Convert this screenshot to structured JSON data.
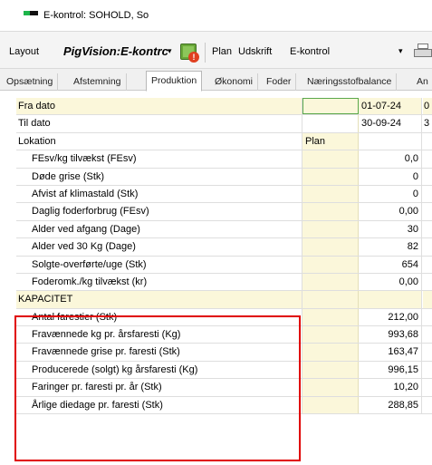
{
  "window": {
    "title": "E-kontrol: SOHOLD, So"
  },
  "toolbar": {
    "layout_label": "Layout",
    "layout_value": "PigVision:E-kontrc",
    "dropdown_glyph": "▾",
    "plan_label": "Plan",
    "udskrift_label": "Udskrift",
    "udskrift_value": "E-kontrol"
  },
  "tabs": [
    "Opsætning",
    "Afstemning",
    "Produktion",
    "Økonomi",
    "Foder",
    "Næringsstofbalance",
    "An"
  ],
  "active_tab": "Produktion",
  "grid": {
    "rows": [
      {
        "label": "Fra dato",
        "plan": "",
        "value": "01-07-24",
        "edge": "0"
      },
      {
        "label": "Til dato",
        "plan": "",
        "value": "30-09-24",
        "edge": "3"
      },
      {
        "label": "Lokation",
        "plan": "Plan",
        "value": "",
        "edge": ""
      },
      {
        "label": "FEsv/kg tilvækst (FEsv)",
        "plan": "",
        "value": "0,0",
        "edge": ""
      },
      {
        "label": "Døde grise (Stk)",
        "plan": "",
        "value": "0",
        "edge": ""
      },
      {
        "label": "Afvist af klimastald (Stk)",
        "plan": "",
        "value": "0",
        "edge": ""
      },
      {
        "label": "Daglig foderforbrug (FEsv)",
        "plan": "",
        "value": "0,00",
        "edge": ""
      },
      {
        "label": "Alder ved afgang (Dage)",
        "plan": "",
        "value": "30",
        "edge": ""
      },
      {
        "label": "Alder ved 30 Kg (Dage)",
        "plan": "",
        "value": "82",
        "edge": ""
      },
      {
        "label": "Solgte-overførte/uge (Stk)",
        "plan": "",
        "value": "654",
        "edge": ""
      },
      {
        "label": "Foderomk./kg tilvækst (kr)",
        "plan": "",
        "value": "0,00",
        "edge": ""
      },
      {
        "label": "KAPACITET",
        "plan": "",
        "value": "",
        "edge": ""
      },
      {
        "label": "Antal farestier (Stk)",
        "plan": "",
        "value": "212,00",
        "edge": ""
      },
      {
        "label": "Fravænnede kg pr. årsfaresti (Kg)",
        "plan": "",
        "value": "993,68",
        "edge": ""
      },
      {
        "label": "Fravænnede grise pr. faresti (Stk)",
        "plan": "",
        "value": "163,47",
        "edge": ""
      },
      {
        "label": "Producerede (solgt) kg årsfaresti (Kg)",
        "plan": "",
        "value": "996,15",
        "edge": ""
      },
      {
        "label": "Faringer pr. faresti pr. år (Stk)",
        "plan": "",
        "value": "10,20",
        "edge": ""
      },
      {
        "label": "Årlige diedage pr. faresti (Stk)",
        "plan": "",
        "value": "288,85",
        "edge": ""
      }
    ]
  },
  "colors": {
    "highlight_box": "#e00000",
    "plan_column": "#fbf7da",
    "selected_cell": "#5aa84a"
  }
}
